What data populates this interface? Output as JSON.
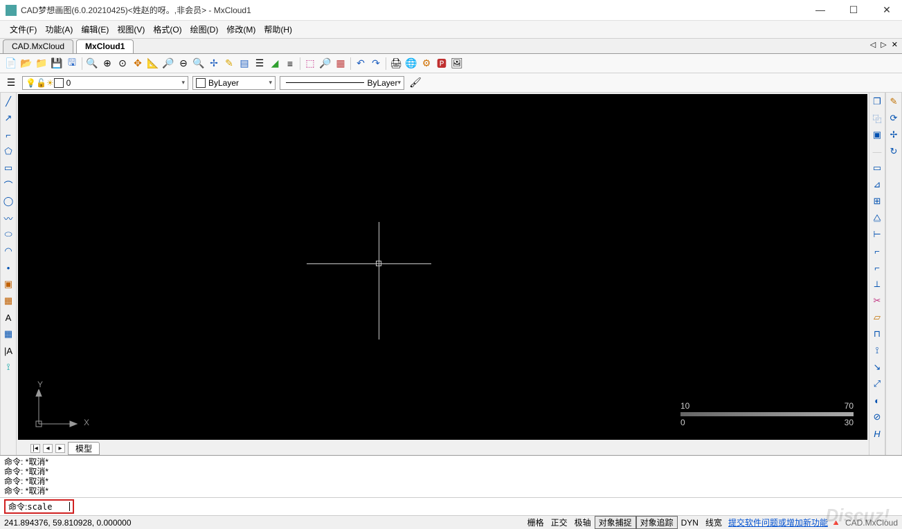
{
  "title": "CAD梦想画图(6.0.20210425)<姓赵的呀。,非会员> - MxCloud1",
  "menu": [
    "文件(F)",
    "功能(A)",
    "编辑(E)",
    "视图(V)",
    "格式(O)",
    "绘图(D)",
    "修改(M)",
    "帮助(H)"
  ],
  "tabs": {
    "items": [
      "CAD.MxCloud",
      "MxCloud1"
    ],
    "activeIndex": 1
  },
  "tabnav": "◁ ▷ ✕",
  "layer": {
    "current": "0",
    "bylayer1": "ByLayer",
    "bylayer2": "ByLayer"
  },
  "ucs": {
    "y": "Y",
    "x": "X"
  },
  "scale": {
    "t1": "10",
    "t2": "70",
    "b1": "0",
    "b2": "30"
  },
  "modelTab": "模型",
  "cmdhist": [
    "命令:  *取消*",
    "命令:  *取消*",
    "命令:  *取消*",
    "命令:  *取消*"
  ],
  "cmd": {
    "prompt": "命令: ",
    "value": "scale"
  },
  "status": {
    "coords": "241.894376, 59.810928,  0.000000",
    "buttons": [
      "栅格",
      "正交",
      "极轴",
      "对象捕捉",
      "对象追踪",
      "DYN",
      "线宽"
    ],
    "boxed": [
      3,
      4
    ],
    "link": "提交软件问题或增加新功能",
    "brand": "CAD.MxCloud"
  },
  "watermark": "Discuz!"
}
